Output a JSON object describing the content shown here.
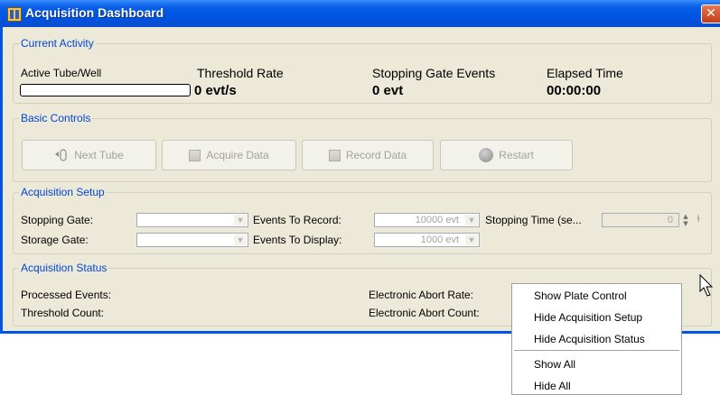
{
  "window": {
    "title": "Acquisition Dashboard",
    "close_glyph": "✕"
  },
  "current_activity": {
    "legend": "Current Activity",
    "labels": {
      "active_tube": "Active Tube/Well",
      "threshold_rate": "Threshold Rate",
      "stopping_gate_events": "Stopping Gate Events",
      "elapsed_time": "Elapsed Time"
    },
    "values": {
      "threshold_rate": "0 evt/s",
      "stopping_gate_events": "0 evt",
      "elapsed_time": "00:00:00"
    },
    "active_tube_progress": 0
  },
  "basic_controls": {
    "legend": "Basic Controls",
    "next_tube": "Next Tube",
    "acquire_data": "Acquire Data",
    "record_data": "Record Data",
    "restart": "Restart"
  },
  "acquisition_setup": {
    "legend": "Acquisition Setup",
    "stopping_gate_label": "Stopping Gate:",
    "storage_gate_label": "Storage Gate:",
    "events_to_record_label": "Events To Record:",
    "events_to_record_value": "10000 evt",
    "events_to_display_label": "Events To Display:",
    "events_to_display_value": "1000 evt",
    "stopping_time_label": "Stopping Time (se...",
    "stopping_time_value": "0"
  },
  "acquisition_status": {
    "legend": "Acquisition Status",
    "processed_events_label": "Processed Events:",
    "threshold_count_label": "Threshold Count:",
    "electronic_abort_rate_label": "Electronic Abort Rate:",
    "electronic_abort_count_label": "Electronic Abort Count:"
  },
  "context_menu": {
    "items": [
      "Show Plate Control",
      "Hide Acquisition Setup",
      "Hide Acquisition Status",
      "Show All",
      "Hide All"
    ]
  },
  "colors": {
    "titlebar": "#0054e3",
    "window_bg": "#ece9d8",
    "group_legend": "#0046d5",
    "disabled_text": "#a5a39a"
  }
}
